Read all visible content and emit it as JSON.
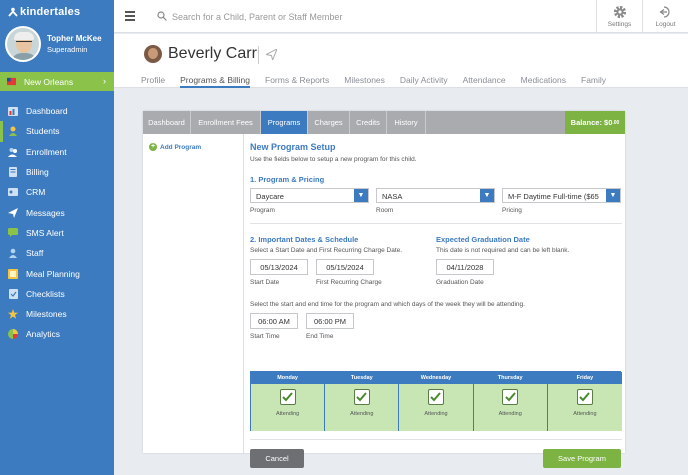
{
  "app": {
    "brand": "kindertales"
  },
  "user": {
    "name": "Topher McKee",
    "role": "Superadmin"
  },
  "location": {
    "name": "New Orleans"
  },
  "nav": [
    {
      "label": "Dashboard",
      "icon": "dashboard-icon"
    },
    {
      "label": "Students",
      "icon": "students-icon"
    },
    {
      "label": "Enrollment",
      "icon": "enrollment-icon"
    },
    {
      "label": "Billing",
      "icon": "billing-icon"
    },
    {
      "label": "CRM",
      "icon": "crm-icon"
    },
    {
      "label": "Messages",
      "icon": "messages-icon"
    },
    {
      "label": "SMS Alert",
      "icon": "sms-icon"
    },
    {
      "label": "Staff",
      "icon": "staff-icon"
    },
    {
      "label": "Meal Planning",
      "icon": "meal-icon"
    },
    {
      "label": "Checklists",
      "icon": "checklist-icon"
    },
    {
      "label": "Milestones",
      "icon": "star-icon"
    },
    {
      "label": "Analytics",
      "icon": "analytics-icon"
    }
  ],
  "topbar": {
    "search_placeholder": "Search for a Child, Parent or Staff Member",
    "settings": "Settings",
    "logout": "Logout"
  },
  "profile": {
    "name": "Beverly Carr"
  },
  "profile_tabs": [
    "Profile",
    "Programs & Billing",
    "Forms & Reports",
    "Milestones",
    "Daily Activity",
    "Attendance",
    "Medications",
    "Family"
  ],
  "panel_tabs": [
    "Dashboard",
    "Enrollment Fees",
    "Programs",
    "Charges",
    "Credits",
    "History"
  ],
  "balance": {
    "label": "Balance: $0",
    "cents": ".00"
  },
  "add_program": "Add Program",
  "form": {
    "title": "New Program Setup",
    "subtitle": "Use the fields below to setup a new program for this child.",
    "section1": "1. Program & Pricing",
    "program": {
      "value": "Daycare",
      "label": "Program"
    },
    "room": {
      "value": "NASA",
      "label": "Room"
    },
    "pricing": {
      "value": "M-F Daytime Full-time ($65",
      "label": "Pricing"
    },
    "section2": "2. Important Dates & Schedule",
    "section2_hint": "Select a Start Date and First Recurring Charge Date.",
    "start_date": {
      "value": "05/13/2024",
      "label": "Start Date"
    },
    "first_charge": {
      "value": "05/15/2024",
      "label": "First Recurring Charge"
    },
    "grad_title": "Expected Graduation Date",
    "grad_hint": "This date is not required and can be left blank.",
    "grad_date": {
      "value": "04/11/2028",
      "label": "Graduation Date"
    },
    "time_hint": "Select the start and end time for the program and which days of the week they will be attending.",
    "start_time": {
      "value": "06:00 AM",
      "label": "Start Time"
    },
    "end_time": {
      "value": "06:00 PM",
      "label": "End Time"
    },
    "days": [
      {
        "name": "Monday",
        "status": "Attending"
      },
      {
        "name": "Tuesday",
        "status": "Attending"
      },
      {
        "name": "Wednesday",
        "status": "Attending"
      },
      {
        "name": "Thursday",
        "status": "Attending"
      },
      {
        "name": "Friday",
        "status": "Attending"
      }
    ],
    "cancel": "Cancel",
    "save": "Save Program"
  }
}
